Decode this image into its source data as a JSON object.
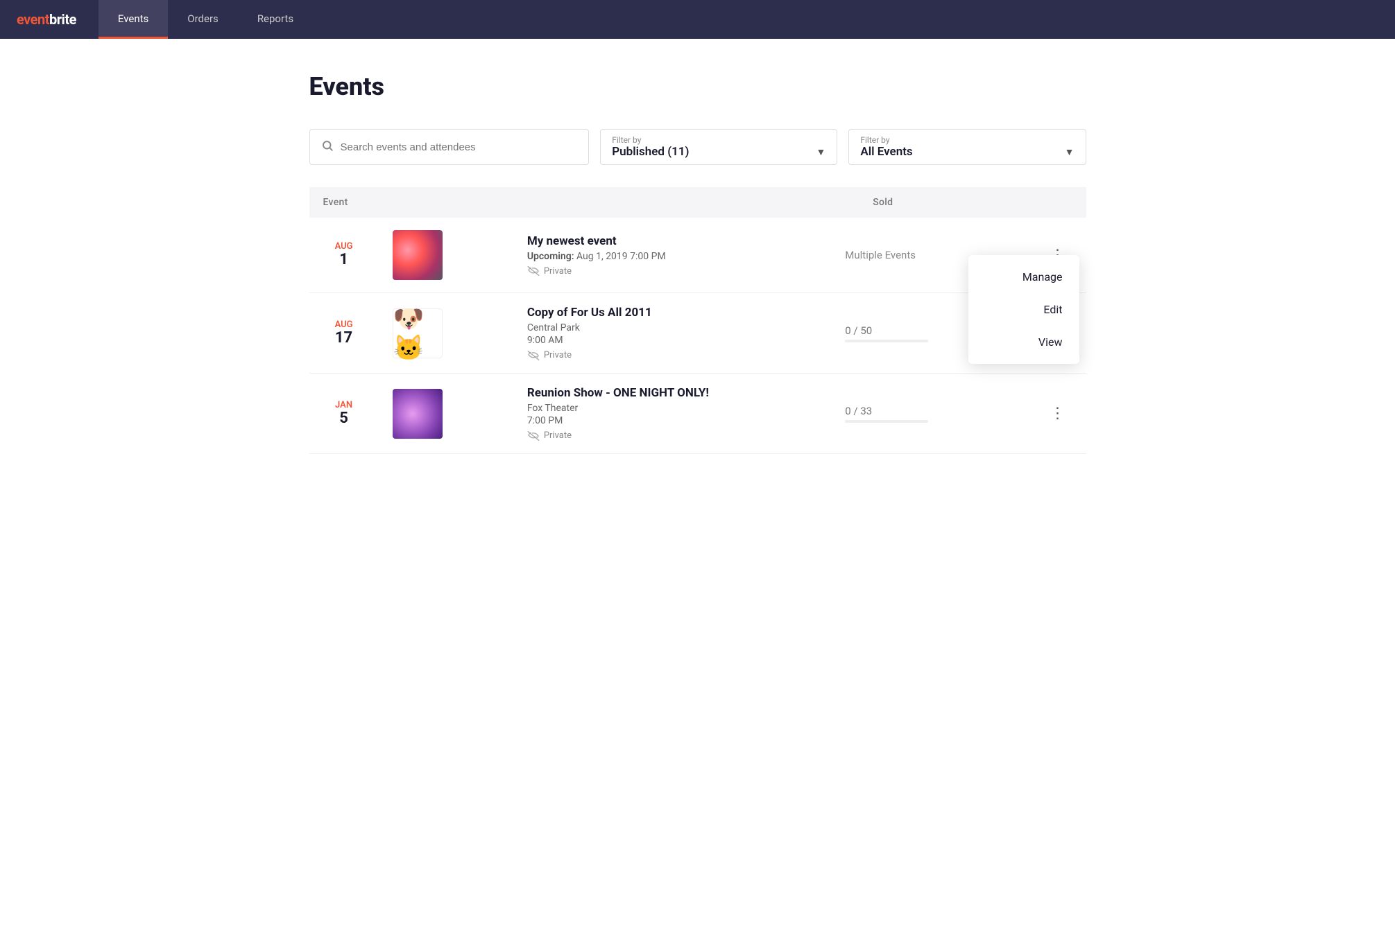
{
  "app": {
    "logo": "eventbrite"
  },
  "nav": {
    "items": [
      {
        "id": "events",
        "label": "Events",
        "active": true
      },
      {
        "id": "orders",
        "label": "Orders",
        "active": false
      },
      {
        "id": "reports",
        "label": "Reports",
        "active": false
      }
    ]
  },
  "page": {
    "title": "Events"
  },
  "search": {
    "placeholder": "Search events and attendees"
  },
  "filter_published": {
    "label": "Filter by",
    "value": "Published (11)"
  },
  "filter_events": {
    "label": "Filter by",
    "value": "All Events"
  },
  "table": {
    "col_event": "Event",
    "col_sold": "Sold"
  },
  "events": [
    {
      "id": 1,
      "date_month": "Aug",
      "date_day": "1",
      "name": "My newest event",
      "upcoming_label": "Upcoming:",
      "upcoming_date": "Aug 1, 2019 7:00 PM",
      "location": "",
      "time": "",
      "is_private": true,
      "sold": "Multiple Events",
      "sold_fraction": "",
      "image_type": "bokeh",
      "has_menu": true,
      "menu_open": true
    },
    {
      "id": 2,
      "date_month": "Aug",
      "date_day": "17",
      "name": "Copy of For Us All 2011",
      "upcoming_label": "",
      "upcoming_date": "",
      "location": "Central Park",
      "time": "9:00 AM",
      "is_private": true,
      "sold": "0 / 50",
      "sold_fraction": "0/50",
      "sold_pct": 0,
      "image_type": "cartoon",
      "has_menu": true,
      "menu_open": false
    },
    {
      "id": 3,
      "date_month": "Jan",
      "date_day": "5",
      "name": "Reunion Show - ONE NIGHT ONLY!",
      "upcoming_label": "",
      "upcoming_date": "",
      "location": "Fox Theater",
      "time": "7:00 PM",
      "is_private": true,
      "sold": "0 / 33",
      "sold_fraction": "0/33",
      "sold_pct": 0,
      "image_type": "purple",
      "has_menu": true,
      "menu_open": false
    }
  ],
  "dropdown_menu": {
    "items": [
      {
        "id": "manage",
        "label": "Manage"
      },
      {
        "id": "edit",
        "label": "Edit"
      },
      {
        "id": "view",
        "label": "View"
      }
    ]
  }
}
